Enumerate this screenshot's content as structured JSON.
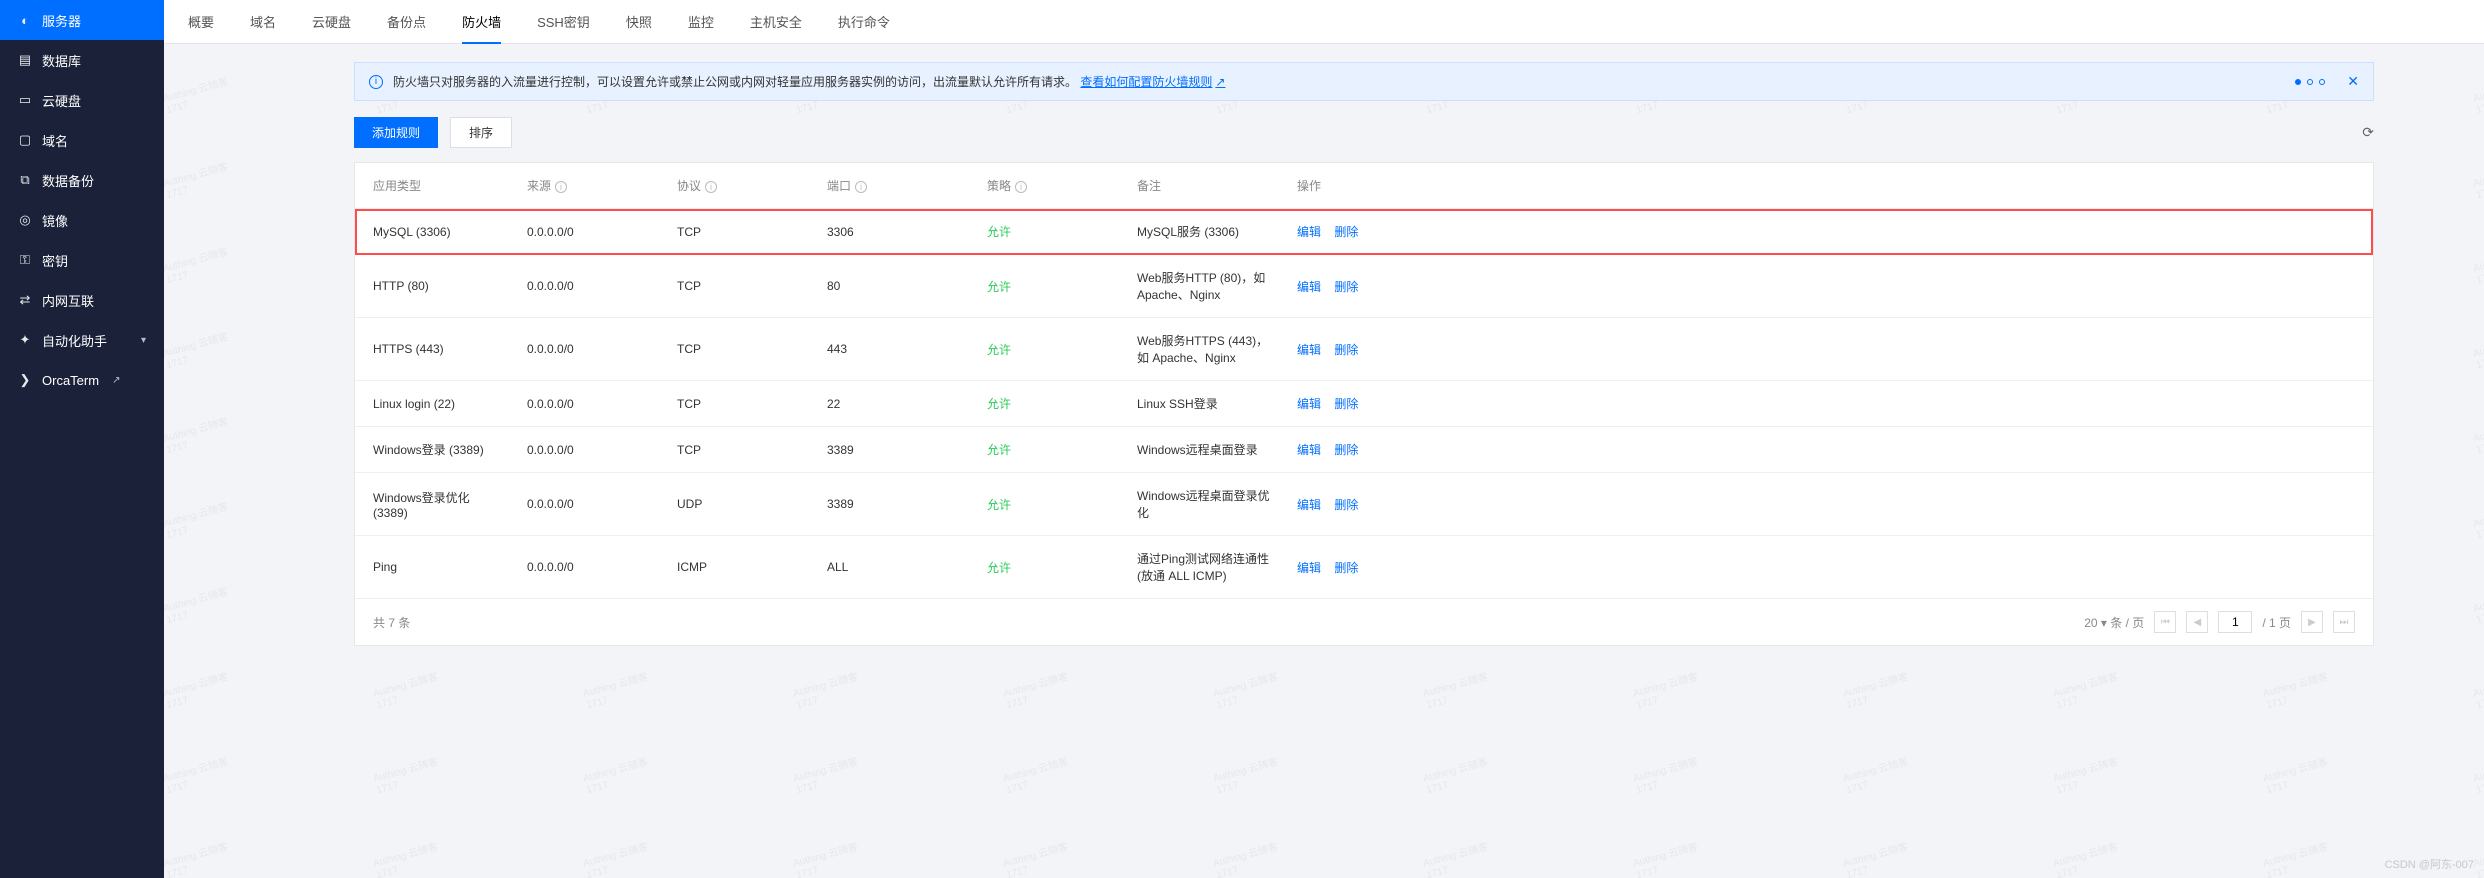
{
  "sidebar": {
    "items": [
      {
        "icon": "shield-icon",
        "label": "服务器",
        "active": true
      },
      {
        "icon": "database-icon",
        "label": "数据库"
      },
      {
        "icon": "disk-icon",
        "label": "云硬盘"
      },
      {
        "icon": "domain-icon",
        "label": "域名"
      },
      {
        "icon": "backup-icon",
        "label": "数据备份"
      },
      {
        "icon": "image-icon",
        "label": "镜像"
      },
      {
        "icon": "key-icon",
        "label": "密钥"
      },
      {
        "icon": "network-icon",
        "label": "内网互联"
      },
      {
        "icon": "automation-icon",
        "label": "自动化助手",
        "caret": true,
        "caret_sym": "▾"
      },
      {
        "icon": "terminal-icon",
        "label": "OrcaTerm",
        "ext": true,
        "ext_sym": "↗"
      }
    ]
  },
  "tabs": {
    "items": [
      "概要",
      "域名",
      "云硬盘",
      "备份点",
      "防火墙",
      "SSH密钥",
      "快照",
      "监控",
      "主机安全",
      "执行命令"
    ],
    "active": "防火墙"
  },
  "alert": {
    "text": "防火墙只对服务器的入流量进行控制，可以设置允许或禁止公网或内网对轻量应用服务器实例的访问，出流量默认允许所有请求。",
    "link": "查看如何配置防火墙规则",
    "link_sym": "↗"
  },
  "toolbar": {
    "add_label": "添加规则",
    "sort_label": "排序",
    "refresh_sym": "⟳"
  },
  "table": {
    "headers": {
      "app": "应用类型",
      "src": "来源",
      "proto": "协议",
      "port": "端口",
      "policy": "策略",
      "remark": "备注",
      "op": "操作"
    },
    "op_edit": "编辑",
    "op_delete": "删除",
    "info_sym": "i",
    "rows": [
      {
        "app": "MySQL (3306)",
        "src": "0.0.0.0/0",
        "proto": "TCP",
        "port": "3306",
        "policy": "允许",
        "remark": "MySQL服务 (3306)",
        "hl": true
      },
      {
        "app": "HTTP (80)",
        "src": "0.0.0.0/0",
        "proto": "TCP",
        "port": "80",
        "policy": "允许",
        "remark": "Web服务HTTP (80)，如 Apache、Nginx"
      },
      {
        "app": "HTTPS (443)",
        "src": "0.0.0.0/0",
        "proto": "TCP",
        "port": "443",
        "policy": "允许",
        "remark": "Web服务HTTPS (443)，如 Apache、Nginx"
      },
      {
        "app": "Linux login (22)",
        "src": "0.0.0.0/0",
        "proto": "TCP",
        "port": "22",
        "policy": "允许",
        "remark": "Linux SSH登录"
      },
      {
        "app": "Windows登录 (3389)",
        "src": "0.0.0.0/0",
        "proto": "TCP",
        "port": "3389",
        "policy": "允许",
        "remark": "Windows远程桌面登录"
      },
      {
        "app": "Windows登录优化 (3389)",
        "src": "0.0.0.0/0",
        "proto": "UDP",
        "port": "3389",
        "policy": "允许",
        "remark": "Windows远程桌面登录优化"
      },
      {
        "app": "Ping",
        "src": "0.0.0.0/0",
        "proto": "ICMP",
        "port": "ALL",
        "policy": "允许",
        "remark": "通过Ping测试网络连通性 (放通 ALL ICMP)"
      }
    ]
  },
  "footer": {
    "total": "共 7 条",
    "page_size": "20",
    "page_size_suffix": "条 / 页",
    "page_current": "1",
    "page_total": "/ 1 页",
    "first": "⏮",
    "prev": "◀",
    "next": "▶",
    "last": "⏭"
  },
  "watermark": {
    "line1": "Authing 云随客",
    "line2": "1717"
  },
  "csdn": "CSDN @阿东-007"
}
